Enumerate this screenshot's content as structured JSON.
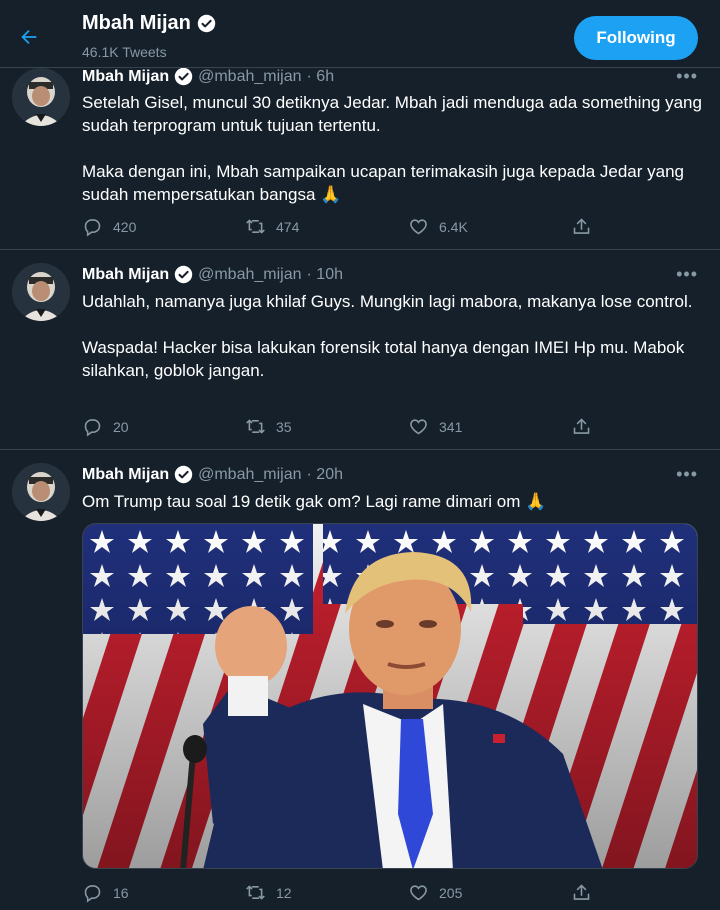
{
  "header": {
    "name": "Mbah Mijan",
    "tweet_count": "46.1K Tweets",
    "follow_label": "Following"
  },
  "tweets": [
    {
      "name": "Mbah Mijan",
      "handle": "@mbah_mijan",
      "time": "· 6h",
      "paragraphs": [
        "Setelah Gisel, muncul 30 detiknya Jedar. Mbah jadi menduga ada something yang sudah terprogram untuk tujuan tertentu.",
        "Maka dengan ini, Mbah sampaikan ucapan terimakasih juga kepada Jedar yang sudah mempersatukan bangsa 🙏"
      ],
      "replies": "420",
      "retweets": "474",
      "likes": "6.4K"
    },
    {
      "name": "Mbah Mijan",
      "handle": "@mbah_mijan",
      "time": "· 10h",
      "paragraphs": [
        "Udahlah, namanya juga khilaf Guys. Mungkin lagi mabora, makanya lose control.",
        "Waspada! Hacker bisa lakukan forensik total hanya dengan IMEI Hp mu. Mabok silahkan, goblok jangan."
      ],
      "replies": "20",
      "retweets": "35",
      "likes": "341"
    },
    {
      "name": "Mbah Mijan",
      "handle": "@mbah_mijan",
      "time": "· 20h",
      "paragraphs": [
        "Om Trump tau soal 19 detik gak om? Lagi rame dimari om 🙏"
      ],
      "replies": "16",
      "retweets": "12",
      "likes": "205"
    }
  ],
  "colors": {
    "background": "#15202b",
    "accent": "#1da1f2",
    "muted": "#8899a6",
    "border": "#38444d"
  },
  "icons": [
    "back-arrow-icon",
    "verified-icon",
    "more-icon",
    "reply-icon",
    "retweet-icon",
    "like-icon",
    "share-icon"
  ]
}
